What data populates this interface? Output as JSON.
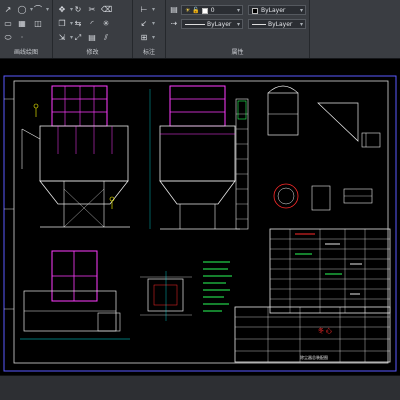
{
  "ribbon": {
    "panels": [
      {
        "title": "画线绘图"
      },
      {
        "title": "修改"
      },
      {
        "title": "标注"
      },
      {
        "title": "属性"
      }
    ],
    "layer_control": {
      "value": "0"
    },
    "color_control": {
      "value": "ByLayer"
    },
    "linetype_control": {
      "value": "ByLayer"
    },
    "lineweight_control": {
      "value": "ByLayer"
    },
    "colors": {
      "accent_magenta": "#ff00ff",
      "accent_red": "#ff3c3c"
    }
  },
  "drawing": {
    "annotations": {
      "title_red_text": "冬 心",
      "bottom_title_block_text": "除尘器总装配图"
    },
    "colors": {
      "frame": "#5a5aff",
      "lines_white": "#e8e8e8",
      "structure_magenta": "#ff3cff",
      "cyan": "#00e6e6",
      "yellow": "#ffff00",
      "green": "#2aff5a",
      "red": "#ff2a2a"
    }
  }
}
